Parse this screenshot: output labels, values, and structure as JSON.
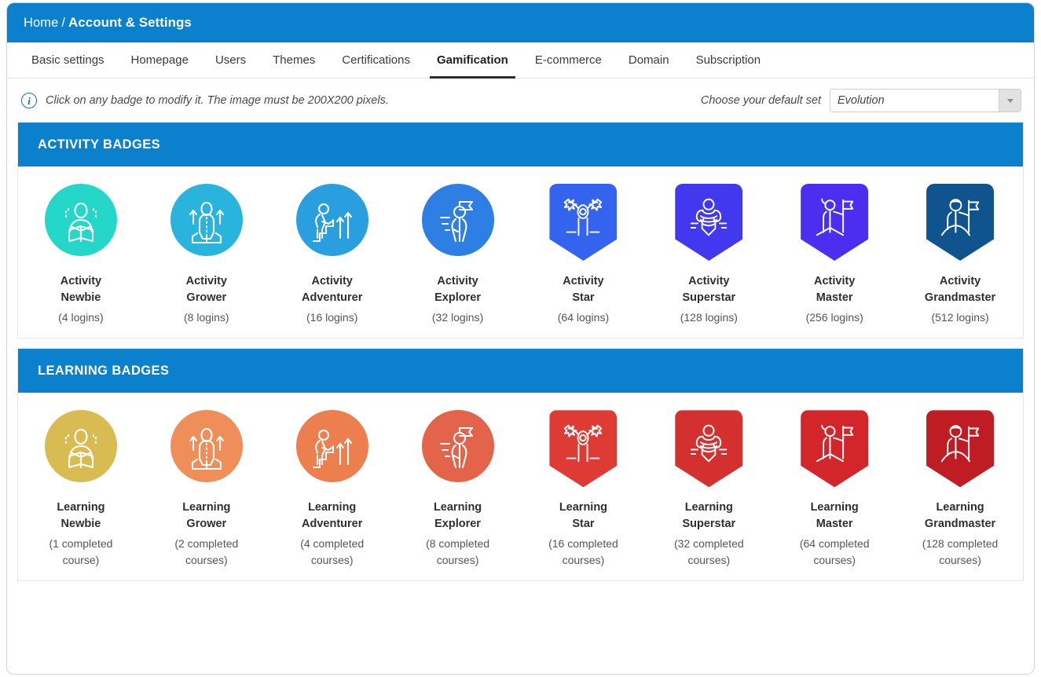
{
  "header": {
    "breadcrumb_home": "Home",
    "breadcrumb_separator": "/",
    "breadcrumb_current": "Account & Settings"
  },
  "tabs": [
    {
      "label": "Basic settings",
      "active": false
    },
    {
      "label": "Homepage",
      "active": false
    },
    {
      "label": "Users",
      "active": false
    },
    {
      "label": "Themes",
      "active": false
    },
    {
      "label": "Certifications",
      "active": false
    },
    {
      "label": "Gamification",
      "active": true
    },
    {
      "label": "E-commerce",
      "active": false
    },
    {
      "label": "Domain",
      "active": false
    },
    {
      "label": "Subscription",
      "active": false
    }
  ],
  "info": {
    "icon": "info-circle-icon",
    "text": "Click on any badge to modify it. The image must be 200X200 pixels.",
    "set_label": "Choose your default set",
    "set_value": "Evolution",
    "set_arrow_icon": "chevron-down-icon"
  },
  "colors": {
    "brand_blue": "#0b81cd",
    "border": "#e4e4e4",
    "text_dark": "#2f2f2f"
  },
  "sections": [
    {
      "id": "activity",
      "title": "ACTIVITY BADGES",
      "badges": [
        {
          "title": "Activity\nNewbie",
          "sub": "(4 logins)",
          "shape": "circle",
          "color": "#25d7c8",
          "art": "reader"
        },
        {
          "title": "Activity\nGrower",
          "sub": "(8 logins)",
          "shape": "circle",
          "color": "#29b4dd",
          "art": "grower"
        },
        {
          "title": "Activity\nAdventurer",
          "sub": "(16 logins)",
          "shape": "circle",
          "color": "#2a9fe0",
          "art": "stairs"
        },
        {
          "title": "Activity\nExplorer",
          "sub": "(32 logins)",
          "shape": "circle",
          "color": "#2d7fe3",
          "art": "flagwalker"
        },
        {
          "title": "Activity\nStar",
          "sub": "(64 logins)",
          "shape": "shield",
          "color": "#3463ef",
          "art": "star"
        },
        {
          "title": "Activity\nSuperstar",
          "sub": "(128 logins)",
          "shape": "shield",
          "color": "#4238ef",
          "art": "muscle"
        },
        {
          "title": "Activity\nMaster",
          "sub": "(256 logins)",
          "shape": "shield",
          "color": "#4b2ef0",
          "art": "peakflag"
        },
        {
          "title": "Activity\nGrandmaster",
          "sub": "(512 logins)",
          "shape": "shield",
          "color": "#0f538f",
          "art": "hillflag"
        }
      ]
    },
    {
      "id": "learning",
      "title": "LEARNING BADGES",
      "badges": [
        {
          "title": "Learning\nNewbie",
          "sub": "(1 completed course)",
          "shape": "circle",
          "color": "#d9bc51",
          "art": "reader"
        },
        {
          "title": "Learning\nGrower",
          "sub": "(2 completed courses)",
          "shape": "circle",
          "color": "#ef8e58",
          "art": "grower"
        },
        {
          "title": "Learning\nAdventurer",
          "sub": "(4 completed courses)",
          "shape": "circle",
          "color": "#ed7f4f",
          "art": "stairs"
        },
        {
          "title": "Learning\nExplorer",
          "sub": "(8 completed courses)",
          "shape": "circle",
          "color": "#e3644a",
          "art": "flagwalker"
        },
        {
          "title": "Learning\nStar",
          "sub": "(16 completed courses)",
          "shape": "shield",
          "color": "#dd3b34",
          "art": "star"
        },
        {
          "title": "Learning\nSuperstar",
          "sub": "(32 completed courses)",
          "shape": "shield",
          "color": "#d4302f",
          "art": "muscle"
        },
        {
          "title": "Learning\nMaster",
          "sub": "(64 completed courses)",
          "shape": "shield",
          "color": "#d2262a",
          "art": "peakflag"
        },
        {
          "title": "Learning\nGrandmaster",
          "sub": "(128 completed courses)",
          "shape": "shield",
          "color": "#c01c24",
          "art": "hillflag"
        }
      ]
    }
  ]
}
